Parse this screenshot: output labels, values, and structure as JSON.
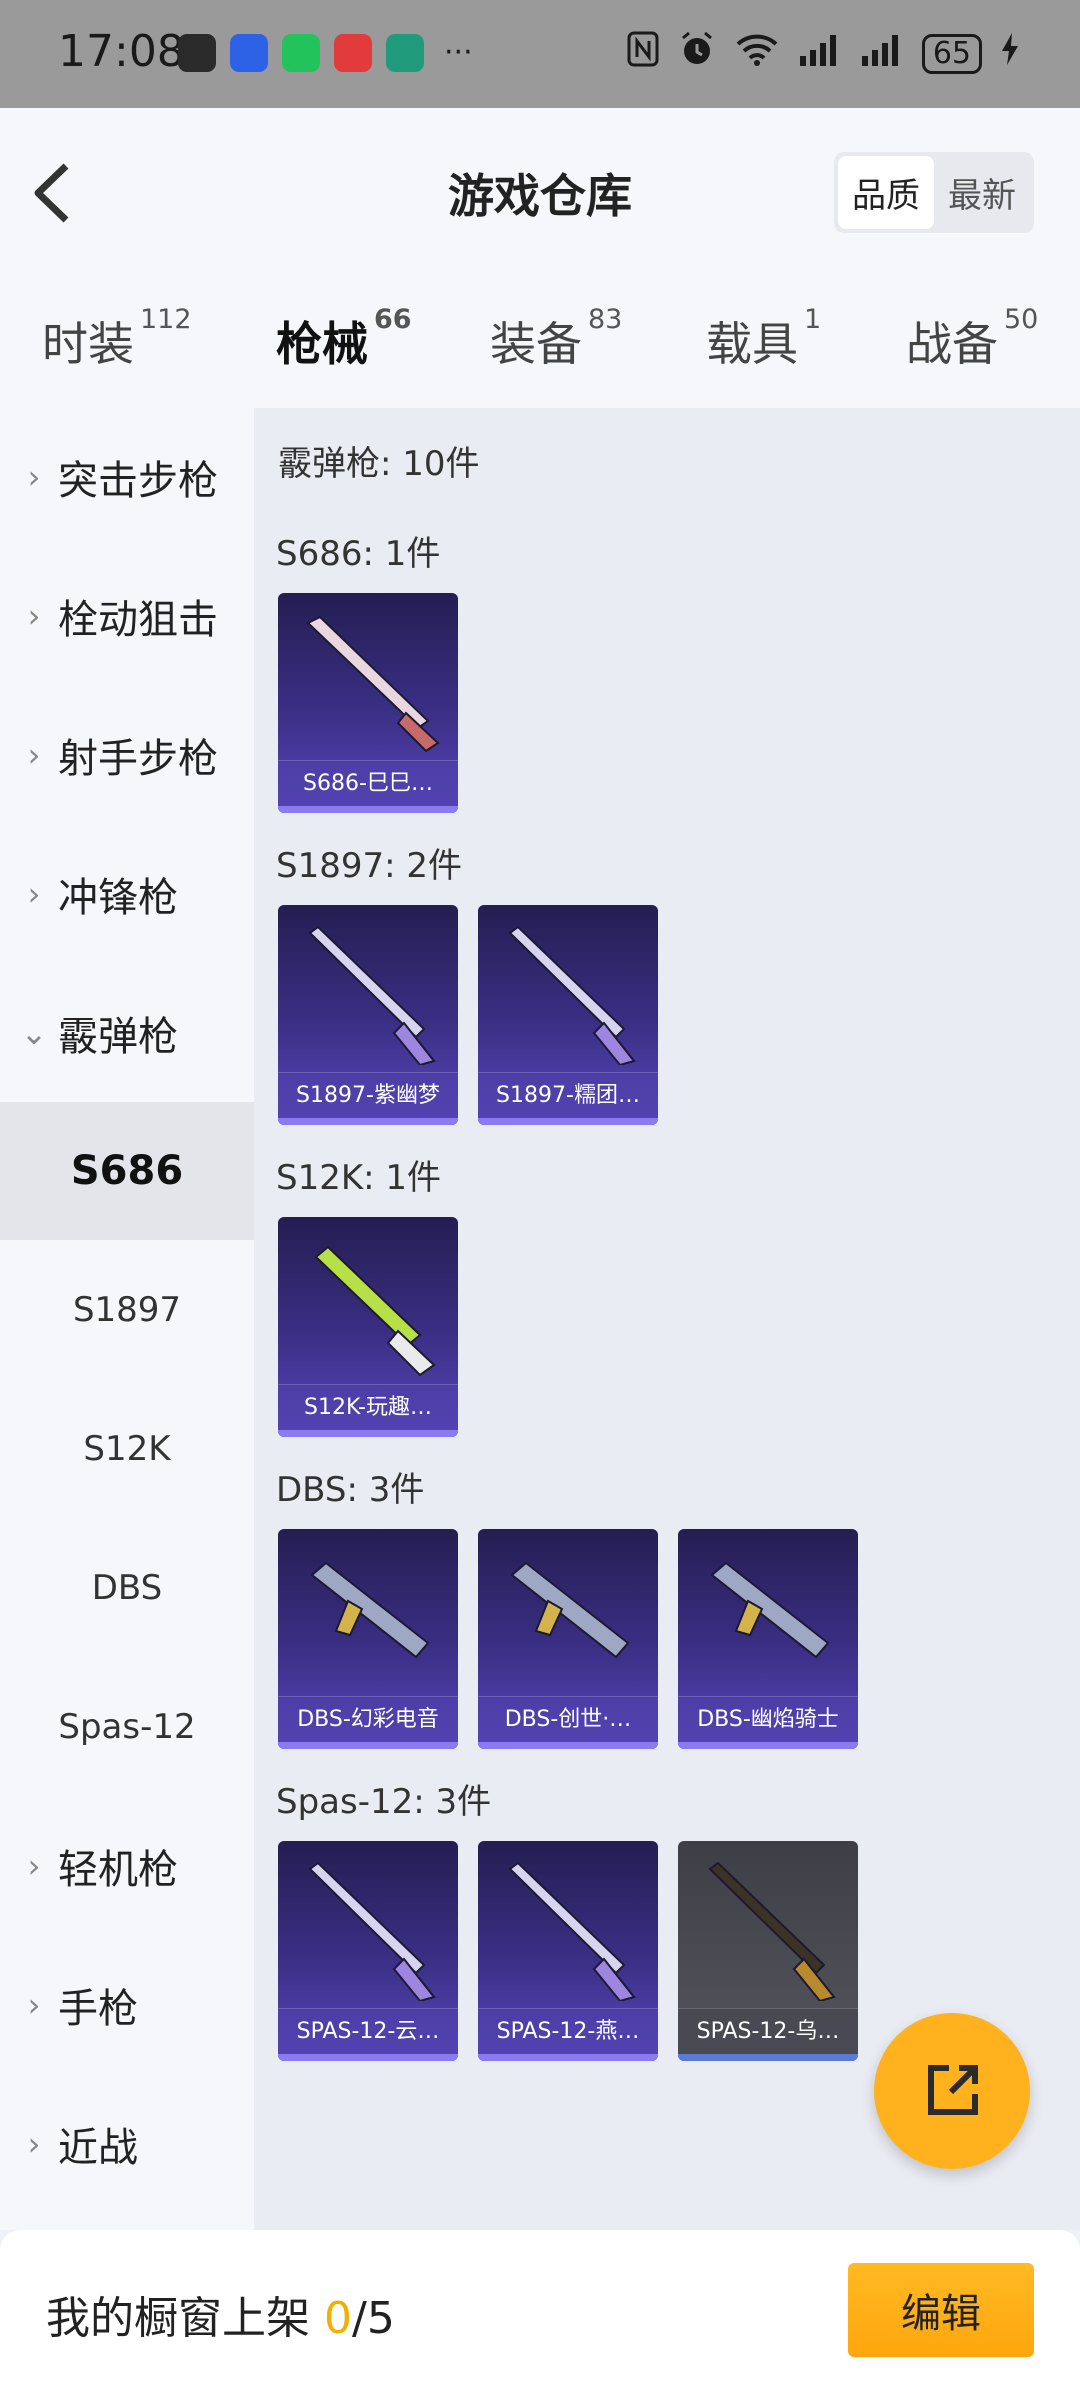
{
  "status_bar": {
    "time": "17:08",
    "more": "···",
    "battery": "65",
    "app_icon_colors": [
      "#2a2a2a",
      "#2d62e6",
      "#21c35a",
      "#e23b3b",
      "#1f9a7a"
    ]
  },
  "header": {
    "title": "游戏仓库",
    "sort_options": [
      "品质",
      "最新"
    ],
    "active_sort": "品质"
  },
  "tabs": [
    {
      "label": "时装",
      "count": "112"
    },
    {
      "label": "枪械",
      "count": "66"
    },
    {
      "label": "装备",
      "count": "83"
    },
    {
      "label": "载具",
      "count": "1"
    },
    {
      "label": "战备",
      "count": "50"
    }
  ],
  "active_tab": "枪械",
  "sidebar": {
    "categories": [
      "突击步枪",
      "栓动狙击",
      "射手步枪",
      "冲锋枪",
      "霰弹枪",
      "轻机枪",
      "手枪",
      "近战"
    ],
    "expanded": "霰弹枪",
    "subitems": [
      "S686",
      "S1897",
      "S12K",
      "DBS",
      "Spas-12"
    ],
    "active_subitem": "S686"
  },
  "content": {
    "total": "霰弹枪: 10件",
    "groups": [
      {
        "title": "S686: 1件",
        "items": [
          {
            "name": "S686-巳巳…",
            "style": "purple",
            "gun": "double"
          }
        ]
      },
      {
        "title": "S1897: 2件",
        "items": [
          {
            "name": "S1897-紫幽梦",
            "style": "purple",
            "gun": "pump"
          },
          {
            "name": "S1897-糯团…",
            "style": "purple",
            "gun": "pump"
          }
        ]
      },
      {
        "title": "S12K: 1件",
        "items": [
          {
            "name": "S12K-玩趣…",
            "style": "purple",
            "gun": "rifle"
          }
        ]
      },
      {
        "title": "DBS: 3件",
        "items": [
          {
            "name": "DBS-幻彩电音",
            "style": "purple",
            "gun": "bullpup"
          },
          {
            "name": "DBS-创世·…",
            "style": "purple",
            "gun": "bullpup"
          },
          {
            "name": "DBS-幽焰骑士",
            "style": "purple",
            "gun": "bullpup"
          }
        ]
      },
      {
        "title": "Spas-12: 3件",
        "items": [
          {
            "name": "SPAS-12-云…",
            "style": "purple",
            "gun": "pump"
          },
          {
            "name": "SPAS-12-燕…",
            "style": "purple",
            "gun": "pump"
          },
          {
            "name": "SPAS-12-乌…",
            "style": "grey",
            "gun": "pump"
          }
        ]
      }
    ]
  },
  "bottom": {
    "showcase_label": "我的橱窗上架 ",
    "showcase_count": "0",
    "showcase_total": "/5",
    "edit_label": "编辑"
  },
  "colors": {
    "accent": "#f4b000",
    "fab": "#ffb21e",
    "card_purple": "#3b2f86"
  },
  "icons": {
    "back": "back-arrow-icon",
    "fab": "share-export-icon",
    "chevron_right": "chevron-right-icon",
    "chevron_down": "chevron-down-icon"
  }
}
